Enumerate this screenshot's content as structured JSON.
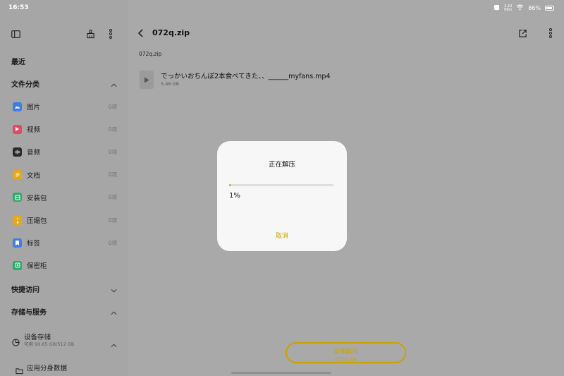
{
  "status_bar": {
    "time": "16:53",
    "speed": "2.10\nKB/s",
    "battery": "86%",
    "battery_level": 0.86
  },
  "sidebar": {
    "recent": "最近",
    "categories_title": "文件分类",
    "categories": [
      {
        "label": "图片",
        "count": "0项",
        "icon": "image-icon",
        "color": "#3d7de6"
      },
      {
        "label": "视频",
        "count": "0项",
        "icon": "video-icon",
        "color": "#e64a5a"
      },
      {
        "label": "音频",
        "count": "0项",
        "icon": "audio-icon",
        "color": "#2b2b2b"
      },
      {
        "label": "文档",
        "count": "0项",
        "icon": "document-icon",
        "color": "#e6a817"
      },
      {
        "label": "安装包",
        "count": "0项",
        "icon": "package-icon",
        "color": "#2daa6b"
      },
      {
        "label": "压缩包",
        "count": "0项",
        "icon": "archive-icon",
        "color": "#e6a817"
      },
      {
        "label": "标签",
        "count": "0项",
        "icon": "tag-icon",
        "color": "#3d7de6"
      },
      {
        "label": "保密柜",
        "count": "",
        "icon": "safe-icon",
        "color": "#2daa6b"
      }
    ],
    "quick_access_title": "快捷访问",
    "storage_title": "存储与服务",
    "device_storage": {
      "name": "设备存储",
      "sub": "可用 90.65 GB/512 GB"
    },
    "app_clone": "应用分身数据"
  },
  "main": {
    "title": "072q.zip",
    "breadcrumb": "072q.zip",
    "file": {
      "name": "でっかいおちんぽ2本食べてきた、、______myfans.mp4",
      "size": "5.46 GB"
    },
    "extract_all": {
      "label": "全部解压",
      "sub": "072q.zip"
    }
  },
  "dialog": {
    "title": "正在解压",
    "progress": 0.01,
    "progress_text": "1%",
    "cancel": "取消"
  },
  "colors": {
    "accent": "#c9a200"
  }
}
